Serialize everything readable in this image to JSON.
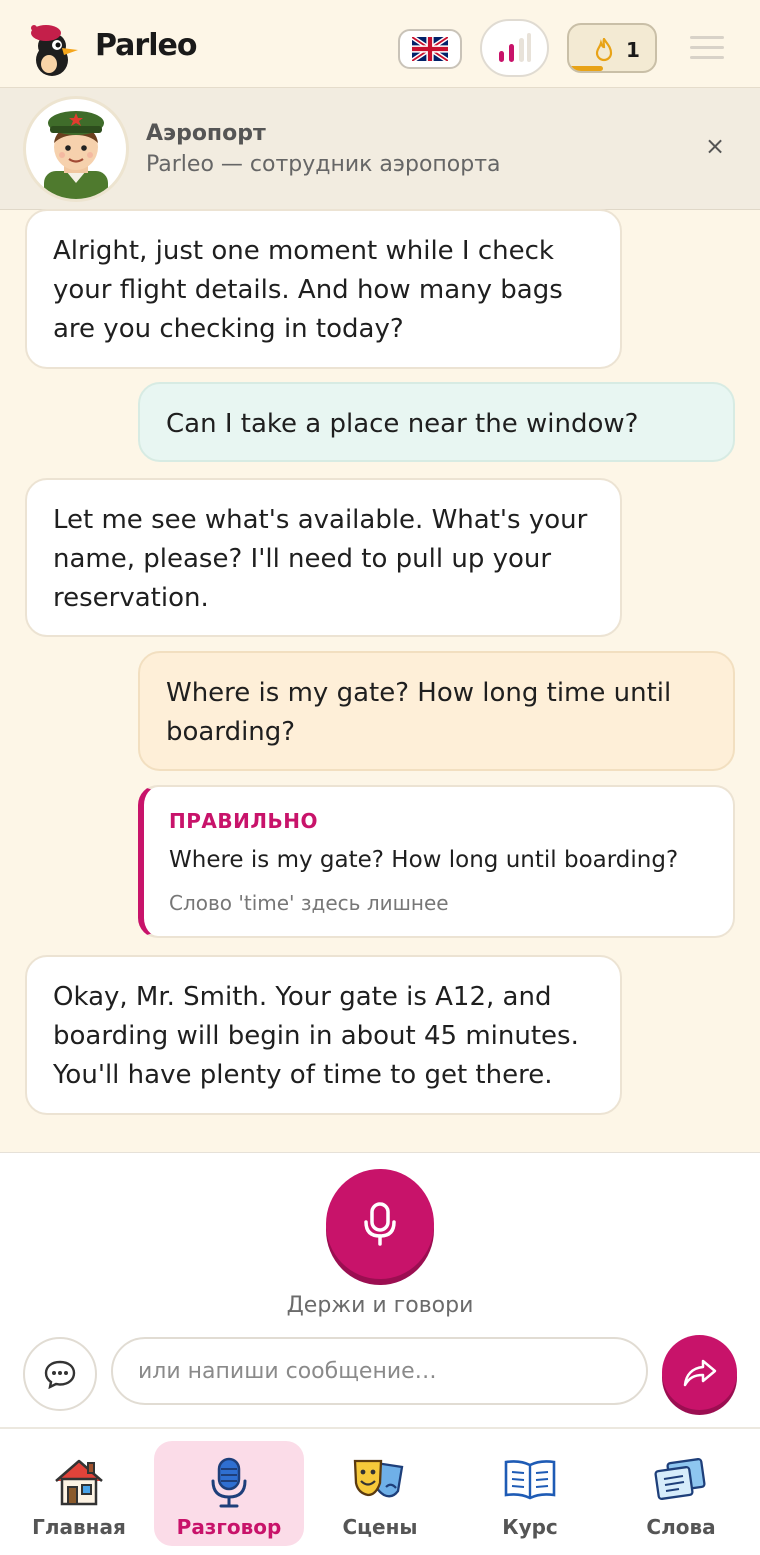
{
  "app": {
    "name": "Parleo"
  },
  "header": {
    "language_flag": "uk-flag-icon",
    "level_icon": "level-bars-icon",
    "streak": {
      "icon": "flame-icon",
      "count": "1",
      "progress": 0.4
    },
    "menu_icon": "hamburger-icon"
  },
  "scene": {
    "title": "Аэропорт",
    "subtitle": "Parleo — сотрудник аэропорта",
    "avatar": "airport-officer-avatar",
    "close_icon": "close-icon"
  },
  "messages": [
    {
      "role": "assistant",
      "text": "Alright, just one moment while I check your flight details. And how many bags are you checking in today?"
    },
    {
      "role": "user",
      "tone": "correct",
      "text": "Can I take a place near the window?"
    },
    {
      "role": "assistant",
      "text": "Let me see what's available. What's your name, please? I'll need to pull up your reservation."
    },
    {
      "role": "user",
      "tone": "needs-correction",
      "text": "Where is my gate? How long time until boarding?"
    },
    {
      "role": "assistant",
      "text": "Okay, Mr. Smith. Your gate is A12, and boarding will begin in about 45 minutes. You'll have plenty of time to get there."
    }
  ],
  "correction": {
    "label": "ПРАВИЛЬНО",
    "text": "Where is my gate? How long until boarding?",
    "note": "Слово 'time' здесь лишнее"
  },
  "composer": {
    "mic_icon": "microphone-icon",
    "hold_hint": "Держи и говори",
    "chat_icon": "speech-bubble-icon",
    "input_placeholder": "или напиши сообщение…",
    "input_value": "",
    "send_icon": "send-arrow-icon"
  },
  "nav": [
    {
      "id": "home",
      "label": "Главная",
      "icon": "house-icon",
      "active": false
    },
    {
      "id": "talk",
      "label": "Разговор",
      "icon": "microphone-icon",
      "active": true
    },
    {
      "id": "scenes",
      "label": "Сцены",
      "icon": "theater-masks-icon",
      "active": false
    },
    {
      "id": "course",
      "label": "Курс",
      "icon": "open-book-icon",
      "active": false
    },
    {
      "id": "words",
      "label": "Слова",
      "icon": "cards-icon",
      "active": false
    }
  ],
  "colors": {
    "accent": "#c8136a",
    "background": "#fdf6e7",
    "user_bubble_correct": "#e8f6f2",
    "user_bubble_error": "#feefd8",
    "streak_progress": "#e8a317"
  }
}
